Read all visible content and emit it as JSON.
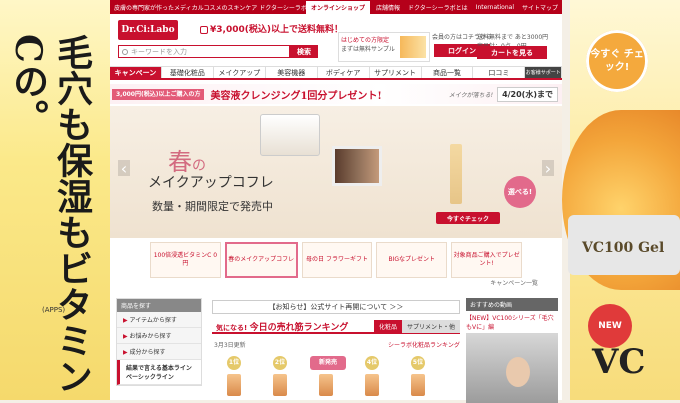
{
  "topbar": {
    "tagline": "皮膚の専門家が作ったメディカルコスメのスキンケア ドクターシーラボ",
    "links": [
      "オンラインショップ",
      "店舗情報",
      "ドクターシーラボとは",
      "International",
      "サイトマップ"
    ]
  },
  "header": {
    "logo": "Dr.Ci:Labo",
    "shipping": "¥3,000(税込)以上で送料無料！",
    "search_placeholder": "キーワードを入力",
    "search_button": "検索",
    "first_title": "はじめての方限定",
    "first_sub": "まずは無料サンプル",
    "member_text": "会員の方はコチラから",
    "login": "ログイン",
    "cart_info": "送料無料まで あと3000円",
    "cart_items": "商品計：0点　0円",
    "cart_button": "カートを見る"
  },
  "nav": [
    "キャンペーン",
    "基礎化粧品",
    "メイクアップ",
    "美容機器",
    "ボディケア",
    "サプリメント",
    "商品一覧",
    "口コミ",
    "お客様サポート"
  ],
  "promo": {
    "chip": "3,000円(税込)以上ご購入の方",
    "text": "美容液クレンジング1回分プレゼント!",
    "small": "メイクが落ちる!",
    "date": "4/20(水)まで"
  },
  "hero": {
    "haru": "春",
    "no": "の",
    "title": "メイクアップコフレ",
    "subtitle": "数量・期間限定で発売中",
    "choose": "選べる!",
    "check": "今すぐチェック"
  },
  "thumbs": [
    "100倍浸透ビタミンC 0円",
    "春のメイクアップコフレ",
    "母の日 フラワーギフト",
    "BIGなプレゼント",
    "対象商品ご購入でプレゼント!"
  ],
  "campaign_link": "キャンペーン一覧",
  "sidebar": {
    "head": "商品を探す",
    "items": [
      "アイテムから探す",
      "お悩みから探す",
      "成分から探す"
    ],
    "feature": "結果で言える基本ライン ベーシックライン"
  },
  "notice": "【お知らせ】公式サイト再開について ＞＞",
  "ranking": {
    "prefix": "気になる! ",
    "title": "今日の売れ筋ランキング",
    "tab1": "化粧品",
    "tab2": "サプリメント・他",
    "date": "3月3日更新",
    "link": "シーラボ化粧品ランキング",
    "items": [
      "1位",
      "2位",
      "新発売",
      "4位",
      "5位"
    ]
  },
  "video": {
    "head": "おすすめの動画",
    "link": "【NEW】VC100シリーズ「毛穴もVに」編"
  },
  "side": {
    "left_text": "毛穴も保湿もビタミンCの。",
    "apps": "(APPS)",
    "check": "今すぐ チェック!",
    "jar_label": "VC100 Gel",
    "new": "NEW",
    "vc": "VC"
  },
  "colors": {
    "brand": "#c8102e",
    "pink": "#e26a8b",
    "gold": "#f4a93d"
  }
}
